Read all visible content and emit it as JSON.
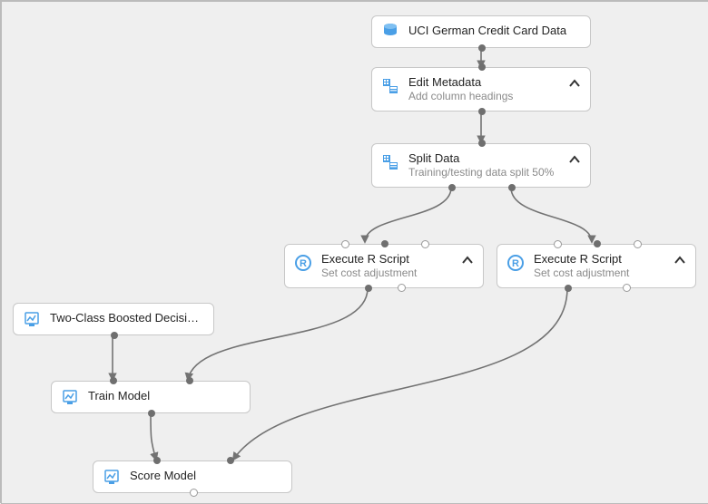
{
  "nodes": {
    "data": {
      "title": "UCI German Credit Card Data",
      "icon": "dataset-icon"
    },
    "editMeta": {
      "title": "Edit Metadata",
      "subtitle": "Add column headings",
      "icon": "metadata-icon",
      "chevron": true
    },
    "splitData": {
      "title": "Split Data",
      "subtitle": "Training/testing data split 50%",
      "icon": "metadata-icon",
      "chevron": true
    },
    "rLeft": {
      "title": "Execute R Script",
      "subtitle": "Set cost adjustment",
      "icon": "r-icon",
      "chevron": true
    },
    "rRight": {
      "title": "Execute R Script",
      "subtitle": "Set cost adjustment",
      "icon": "r-icon",
      "chevron": true
    },
    "twoClass": {
      "title": "Two-Class Boosted Decision...",
      "icon": "model-icon"
    },
    "trainModel": {
      "title": "Train Model",
      "icon": "model-icon"
    },
    "scoreModel": {
      "title": "Score Model",
      "icon": "model-icon"
    }
  },
  "colors": {
    "accent": "#2b7bd6",
    "connector": "#737373",
    "portFill": "#6f6f6f"
  }
}
